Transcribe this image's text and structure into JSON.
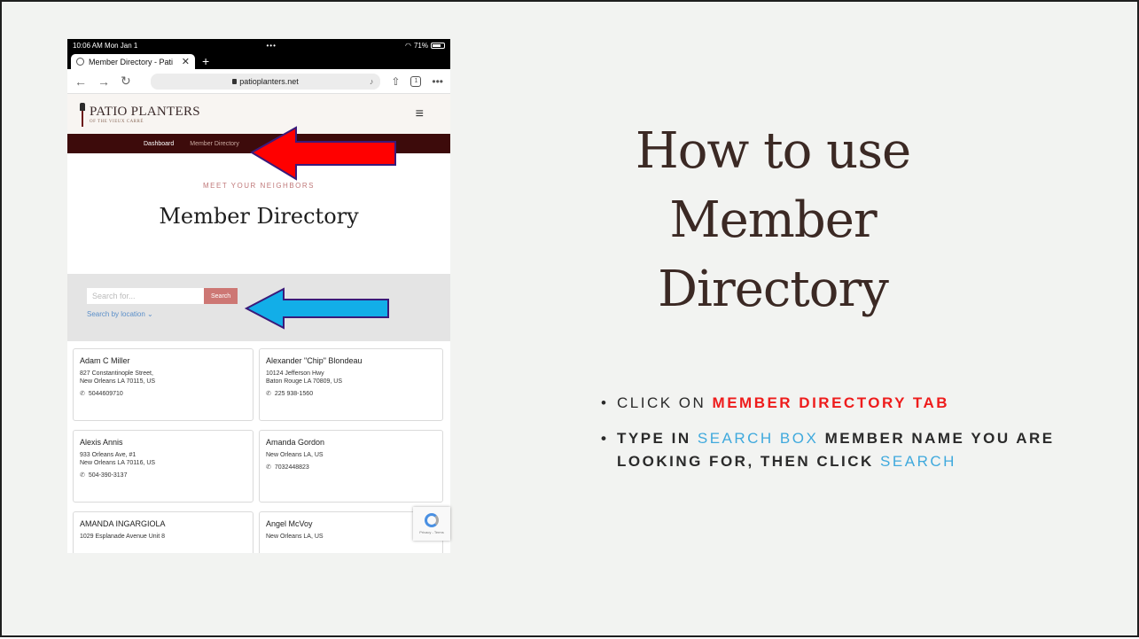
{
  "statusbar": {
    "time": "10:06 AM  Mon Jan 1",
    "dots": "•••",
    "battery": "71%"
  },
  "browser": {
    "tab_title": "Member Directory - Pati",
    "tab_close": "✕",
    "new_tab": "+",
    "url": "patioplanters.net",
    "tab_count": "1",
    "more": "•••"
  },
  "site": {
    "logo_main": "PATIO PLANTERS",
    "logo_sub": "OF THE VIEUX CARRÉ",
    "nav": {
      "dashboard": "Dashboard",
      "member_directory": "Member Directory"
    },
    "eyebrow": "MEET YOUR NEIGHBORS",
    "title": "Member Directory",
    "search": {
      "placeholder": "Search for...",
      "button": "Search",
      "location": "Search by location  ⌄"
    }
  },
  "members": [
    {
      "name": "Adam C Miller",
      "line1": "827 Constantinople Street,",
      "line2": "New Orleans LA 70115, US",
      "phone": "5044609710"
    },
    {
      "name": "Alexander \"Chip\" Blondeau",
      "line1": "10124 Jefferson Hwy",
      "line2": "Baton Rouge LA 70809, US",
      "phone": "225 938-1560"
    },
    {
      "name": "Alexis Annis",
      "line1": "933 Orleans Ave, #1",
      "line2": "New Orleans LA 70116, US",
      "phone": "504-390-3137"
    },
    {
      "name": "Amanda Gordon",
      "line1": "New Orleans LA, US",
      "line2": "",
      "phone": "7032448823"
    },
    {
      "name": "AMANDA INGARGIOLA",
      "line1": "1029 Esplanade Avenue Unit 8",
      "line2": "",
      "phone": ""
    },
    {
      "name": "Angel McVoy",
      "line1": "New Orleans LA, US",
      "line2": "",
      "phone": ""
    }
  ],
  "recaptcha": {
    "text": "Privacy - Terms"
  },
  "slide": {
    "title_line1": "How to use",
    "title_line2": "Member",
    "title_line3": "Directory",
    "bullet1_prefix": "CLICK ON ",
    "bullet1_highlight": "MEMBER DIRECTORY TAB",
    "bullet2_part1": "TYPE IN ",
    "bullet2_highlight1": "SEARCH BOX",
    "bullet2_part2": " MEMBER NAME YOU ARE LOOKING FOR, THEN CLICK ",
    "bullet2_highlight2": "SEARCH"
  },
  "colors": {
    "arrow_red": "#ff0000",
    "arrow_blue": "#12aee8",
    "nav_bg": "#3d0b0b",
    "title": "#3b2924"
  }
}
